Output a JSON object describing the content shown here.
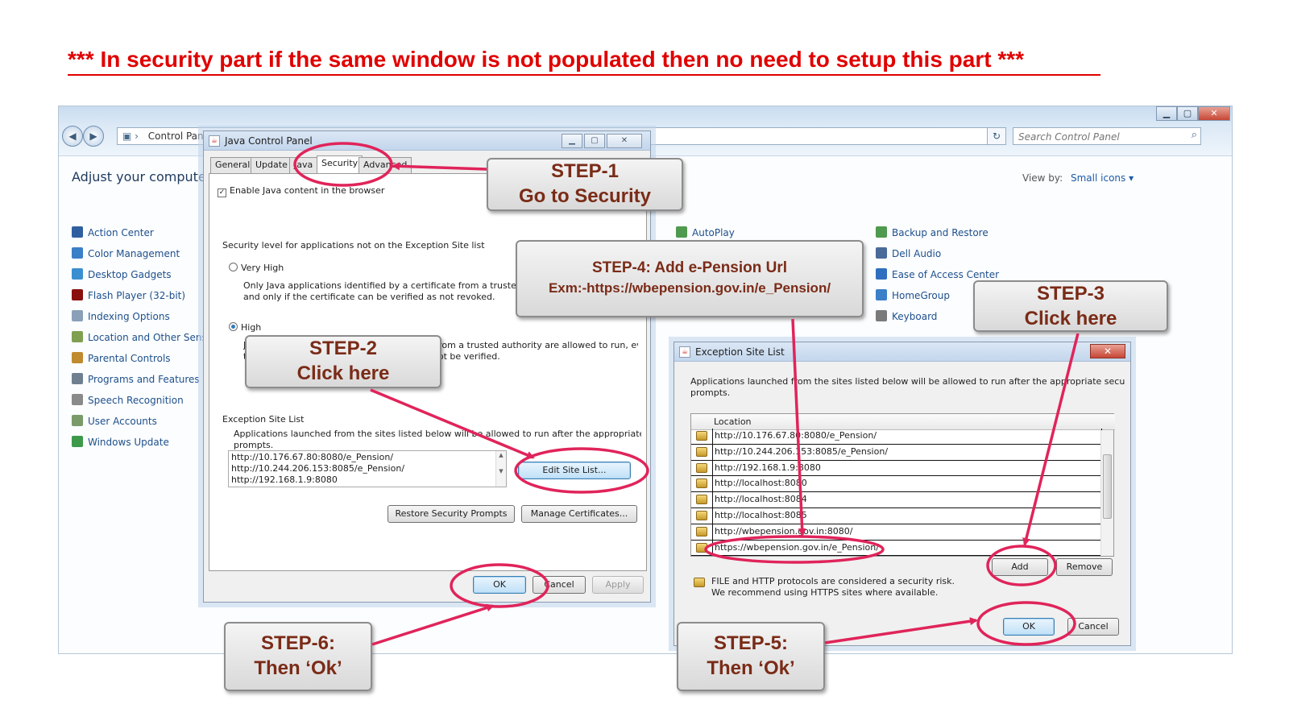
{
  "headline": "*** In security part if the same window is not populated then no need to setup this part ***",
  "control_panel": {
    "address": "Control Panel",
    "search_placeholder": "Search Control Panel",
    "heading": "Adjust your computer's settings",
    "view_by_label": "View by:",
    "view_by_value": "Small icons ▾",
    "items_col1": [
      {
        "label": "Action Center",
        "icon": "flag-icon",
        "color": "#2f5f9f"
      },
      {
        "label": "Color Management",
        "icon": "monitor-icon",
        "color": "#3a7fc8"
      },
      {
        "label": "Desktop Gadgets",
        "icon": "gadget-icon",
        "color": "#3a8fd0"
      },
      {
        "label": "Flash Player (32-bit)",
        "icon": "flash-icon",
        "color": "#8a1010"
      },
      {
        "label": "Indexing Options",
        "icon": "search-user-icon",
        "color": "#8aa0b8"
      },
      {
        "label": "Location and Other Sensors",
        "icon": "sensor-icon",
        "color": "#7fa050"
      },
      {
        "label": "Parental Controls",
        "icon": "family-icon",
        "color": "#c08a30"
      },
      {
        "label": "Programs and Features",
        "icon": "programs-icon",
        "color": "#6f7f90"
      },
      {
        "label": "Speech Recognition",
        "icon": "microphone-icon",
        "color": "#8a8a8a"
      },
      {
        "label": "User Accounts",
        "icon": "users-icon",
        "color": "#7a9a6a"
      },
      {
        "label": "Windows Update",
        "icon": "update-icon",
        "color": "#3c9a4a"
      }
    ],
    "items_col2": [
      {
        "label": "AutoPlay",
        "icon": "autoplay-icon",
        "color": "#4f9a4f"
      }
    ],
    "items_col3": [
      {
        "label": "Backup and Restore",
        "icon": "backup-icon",
        "color": "#4f9a4f"
      },
      {
        "label": "Dell Audio",
        "icon": "audio-icon",
        "color": "#4a6a9a"
      },
      {
        "label": "Ease of Access Center",
        "icon": "ease-icon",
        "color": "#2f6fbf"
      },
      {
        "label": "HomeGroup",
        "icon": "homegroup-icon",
        "color": "#3a7fc8"
      },
      {
        "label": "Keyboard",
        "icon": "keyboard-icon",
        "color": "#7a7a7a"
      }
    ]
  },
  "java_control_panel": {
    "title": "Java Control Panel",
    "tabs": [
      "General",
      "Update",
      "Java",
      "Security",
      "Advanced"
    ],
    "active_tab": "Security",
    "enable_checkbox": "Enable Java content in the browser",
    "security_level_label": "Security level for applications not on the Exception Site list",
    "very_high_label": "Very High",
    "very_high_desc_1": "Only Java applications identified by a certificate from a trusted authority are allowed to run,",
    "very_high_desc_2": "and only if the certificate can be verified as not revoked.",
    "high_label": "High",
    "high_desc_1": "Java applications identified by a certificate from a trusted authority are allowed to run, even if",
    "high_desc_2": "the revocation status of the certificate cannot be verified.",
    "exception_header": "Exception Site List",
    "exception_desc_1": "Applications launched from the sites listed below will be allowed to run after the appropriate security",
    "exception_desc_2": "prompts.",
    "sites": [
      "http://10.176.67.80:8080/e_Pension/",
      "http://10.244.206.153:8085/e_Pension/",
      "http://192.168.1.9:8080"
    ],
    "edit_button": "Edit Site List...",
    "restore_button": "Restore Security Prompts",
    "manage_button": "Manage Certificates...",
    "ok_button": "OK",
    "cancel_button": "Cancel",
    "apply_button": "Apply"
  },
  "exception_dialog": {
    "title": "Exception Site List",
    "desc_1": "Applications launched from the sites listed below will be allowed to run after the appropriate security",
    "desc_2": "prompts.",
    "column_header": "Location",
    "rows": [
      "http://10.176.67.80:8080/e_Pension/",
      "http://10.244.206.153:8085/e_Pension/",
      "http://192.168.1.9:8080",
      "http://localhost:8080",
      "http://localhost:8084",
      "http://localhost:8085",
      "http://wbepension.gov.in:8080/",
      "https://wbepension.gov.in/e_Pension/"
    ],
    "add_button": "Add",
    "remove_button": "Remove",
    "warning_1": "FILE and HTTP protocols are considered a security risk.",
    "warning_2": "We recommend using HTTPS sites where available.",
    "ok_button": "OK",
    "cancel_button": "Cancel"
  },
  "callouts": {
    "step1": {
      "line1": "STEP-1",
      "line2": "Go to Security"
    },
    "step2": {
      "line1": "STEP-2",
      "line2": "Click here"
    },
    "step3": {
      "line1": "STEP-3",
      "line2": "Click here"
    },
    "step4": {
      "line1": "STEP-4:  Add e-Pension Url",
      "line2": "Exm:-https://wbepension.gov.in/e_Pension/"
    },
    "step5": {
      "line1": "STEP-5:",
      "line2": "Then ‘Ok’"
    },
    "step6": {
      "line1": "STEP-6:",
      "line2": "Then ‘Ok’"
    }
  },
  "annotation_color": "#e0245a"
}
